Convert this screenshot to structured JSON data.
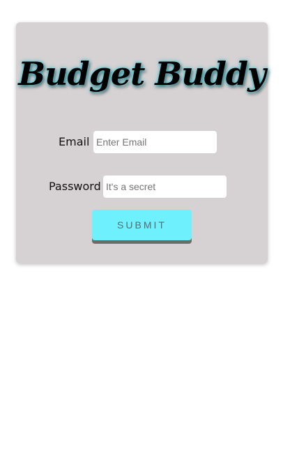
{
  "app": {
    "title": "Budget Buddy"
  },
  "login_form": {
    "email_label": "Email",
    "email_placeholder": "Enter Email",
    "email_value": "",
    "password_label": "Password",
    "password_placeholder": "It's a secret",
    "password_value": "",
    "submit_label": "SUBMIT"
  },
  "colors": {
    "card_background": "#d6d1d2",
    "submit_background": "#6ef0fd",
    "title_glow": "#1ac4d6"
  }
}
